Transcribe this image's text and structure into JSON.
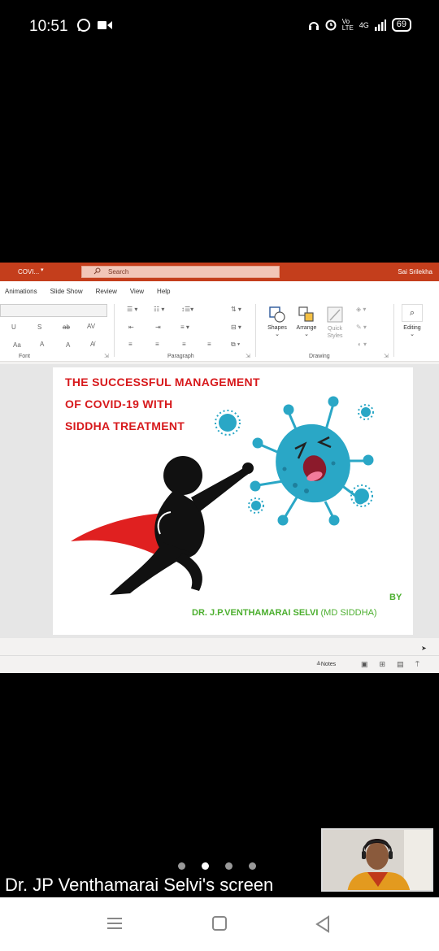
{
  "status": {
    "time": "10:51",
    "network": "4G",
    "vo_lte": "Vo LTE",
    "battery": "69"
  },
  "app": {
    "doc_name": "COVI...",
    "search_placeholder": "Search",
    "user_name": "Sai Srilekha",
    "tabs": [
      "Animations",
      "Slide Show",
      "Review",
      "View",
      "Help"
    ],
    "ribbon": {
      "font_group": "Font",
      "paragraph_group": "Paragraph",
      "drawing_group": "Drawing",
      "shapes": "Shapes",
      "arrange": "Arrange",
      "quick_styles": "Quick Styles",
      "editing": "Editing",
      "font_underline": "U",
      "font_s": "S",
      "font_ab": "ab",
      "font_av": "AV",
      "font_aa": "Aa",
      "font_grow": "A",
      "font_shrink": "A"
    },
    "slide": {
      "title_lines": [
        "THE SUCCESSFUL MANAGEMENT",
        "OF COVID-19 WITH",
        "SIDDHA TREATMENT"
      ],
      "by": "BY",
      "author_name": "DR. J.P.VENTHAMARAI SELVI",
      "author_degree": "(MD SIDDHA)"
    },
    "notes_label": "Notes"
  },
  "meeting": {
    "screen_label": "Dr. JP Venthamarai Selvi's screen",
    "pages": 4,
    "active_page": 1
  },
  "colors": {
    "accent": "#c43e1c",
    "title_red": "#d7191c",
    "author_green": "#4caf2f",
    "virus_blue": "#2aa7c6"
  }
}
